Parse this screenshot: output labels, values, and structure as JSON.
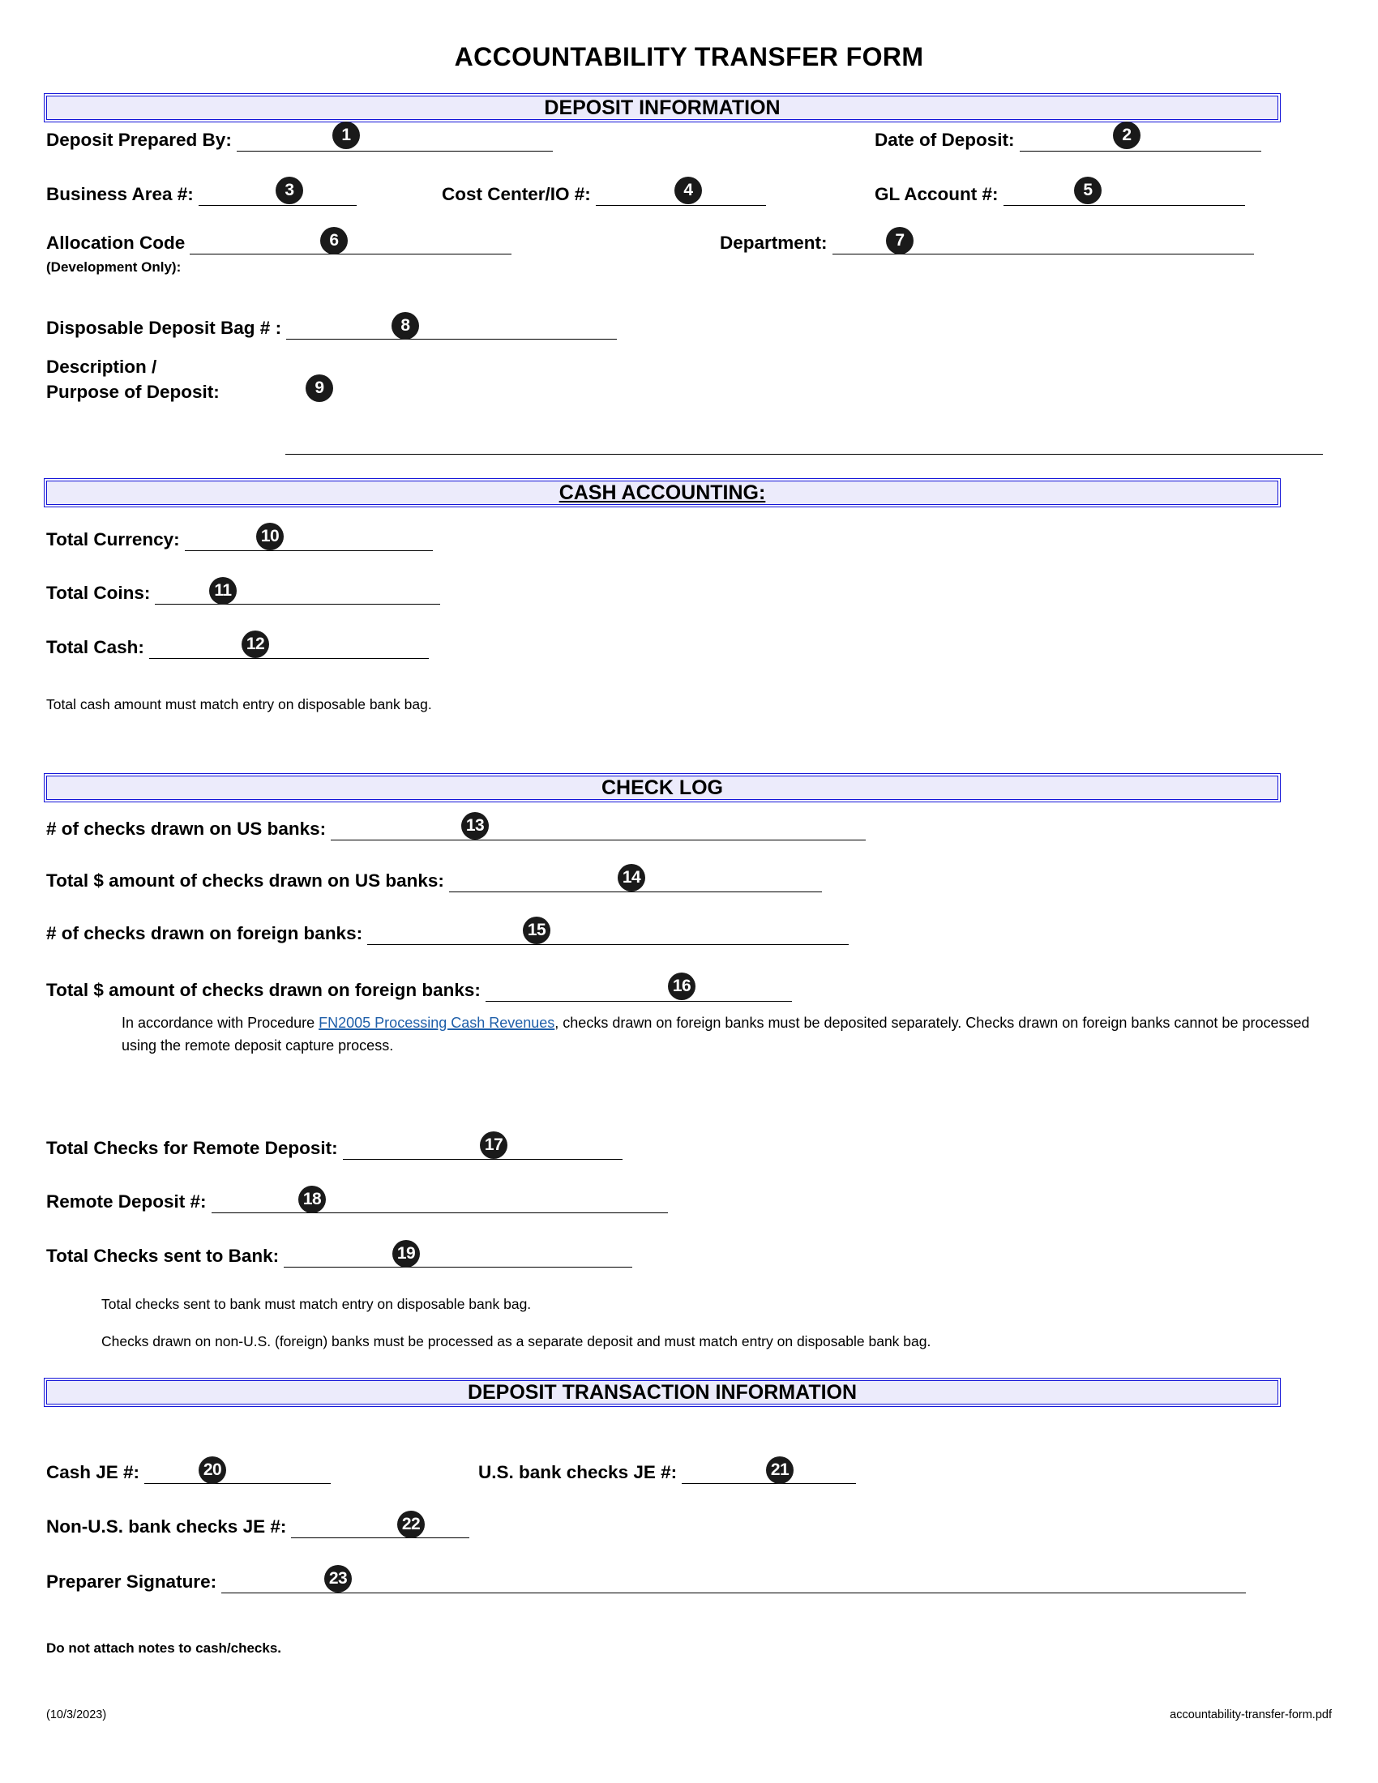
{
  "document": {
    "title": "ACCOUNTABILITY TRANSFER FORM",
    "footer_date": "(10/3/2023)",
    "footer_filename": "accountability-transfer-form.pdf"
  },
  "colors": {
    "section_bar_fill": "#ecebfb",
    "section_bar_border": "#1414d8",
    "badge_fill": "#1a1a1a",
    "link": "#1f5fa9"
  },
  "sections": {
    "deposit_information": {
      "title": "DEPOSIT INFORMATION"
    },
    "cash_accounting": {
      "title": "CASH ACCOUNTING:"
    },
    "check_log": {
      "title": "CHECK LOG"
    },
    "deposit_transaction": {
      "title": "DEPOSIT TRANSACTION INFORMATION"
    }
  },
  "fields": {
    "deposit_prepared_by": {
      "label": "Deposit Prepared By:",
      "value": "",
      "badge": "1"
    },
    "date_of_deposit": {
      "label": "Date of Deposit:",
      "value": "",
      "badge": "2"
    },
    "business_area": {
      "label": "Business Area #:",
      "value": "",
      "badge": "3"
    },
    "cost_center_io": {
      "label": "Cost Center/IO #:",
      "value": "",
      "badge": "4"
    },
    "gl_account": {
      "label": "GL Account #:",
      "value": "",
      "badge": "5"
    },
    "allocation_code": {
      "label": "Allocation Code",
      "sublabel": "(Development Only):",
      "value": "",
      "badge": "6"
    },
    "department": {
      "label": "Department:",
      "value": "",
      "badge": "7"
    },
    "disposable_deposit_bag": {
      "label": "Disposable Deposit Bag # :",
      "value": "",
      "badge": "8"
    },
    "description_purpose": {
      "label_line1": "Description /",
      "label_line2": "Purpose of Deposit:",
      "value": "",
      "badge": "9"
    },
    "total_currency": {
      "label": "Total Currency:",
      "value": "",
      "badge": "10"
    },
    "total_coins": {
      "label": "Total Coins:",
      "value": "",
      "badge": "11"
    },
    "total_cash": {
      "label": "Total Cash:",
      "value": "",
      "badge": "12"
    },
    "checks_us_count": {
      "label": "# of checks drawn on US banks:",
      "value": "",
      "badge": "13"
    },
    "checks_us_amount": {
      "label": "Total $ amount of checks drawn on US banks:",
      "value": "",
      "badge": "14"
    },
    "checks_foreign_count": {
      "label": "# of checks drawn on foreign banks:",
      "value": "",
      "badge": "15"
    },
    "checks_foreign_amount": {
      "label": "Total $ amount of checks drawn on foreign banks:",
      "value": "",
      "badge": "16"
    },
    "total_checks_remote": {
      "label": "Total Checks for Remote Deposit:",
      "value": "",
      "badge": "17"
    },
    "remote_deposit_number": {
      "label": "Remote Deposit #:",
      "value": "",
      "badge": "18"
    },
    "total_checks_sent": {
      "label": "Total Checks sent to Bank:",
      "value": "",
      "badge": "19"
    },
    "cash_je": {
      "label": "Cash JE #:",
      "value": "",
      "badge": "20"
    },
    "us_bank_checks_je": {
      "label": "U.S. bank checks JE #:",
      "value": "",
      "badge": "21"
    },
    "non_us_bank_checks_je": {
      "label": "Non-U.S. bank checks JE #:",
      "value": "",
      "badge": "22"
    },
    "preparer_signature": {
      "label": "Preparer Signature:",
      "value": "",
      "badge": "23"
    }
  },
  "notes": {
    "cash_match": "Total cash amount must match entry on disposable bank bag.",
    "foreign_procedure_prefix": "In accordance with Procedure ",
    "foreign_procedure_link": "FN2005 Processing Cash Revenues",
    "foreign_procedure_suffix": ", checks drawn on foreign banks must be deposited separately. Checks drawn on foreign banks cannot be processed using the remote deposit capture process.",
    "checks_match": "Total checks sent to bank must match entry on disposable bank bag.",
    "foreign_separate": "Checks drawn on non-U.S. (foreign) banks must be processed as a separate deposit and must match entry on disposable bank bag.",
    "do_not_attach": "Do not attach notes to cash/checks."
  }
}
